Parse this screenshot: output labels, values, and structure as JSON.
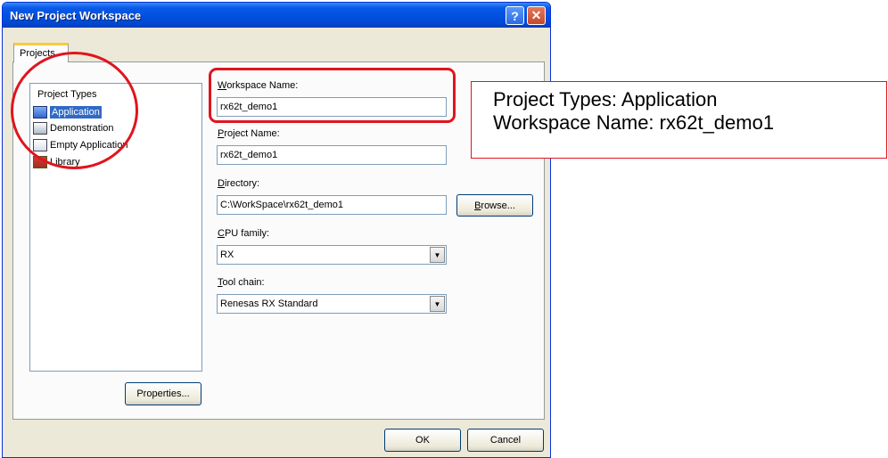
{
  "window": {
    "title": "New Project Workspace",
    "help_glyph": "?",
    "close_glyph": "✕"
  },
  "tabs": [
    {
      "label": "Projects"
    }
  ],
  "project_types": {
    "header": "Project Types",
    "items": [
      {
        "label": "Application",
        "icon": "application-icon",
        "selected": true
      },
      {
        "label": "Demonstration",
        "icon": "demonstration-icon",
        "selected": false
      },
      {
        "label": "Empty Application",
        "icon": "empty-application-icon",
        "selected": false
      },
      {
        "label": "Library",
        "icon": "library-icon",
        "selected": false
      }
    ]
  },
  "properties_button": "Properties...",
  "fields": {
    "workspace_name": {
      "label_accel": "W",
      "label_rest": "orkspace Name:",
      "value": "rx62t_demo1"
    },
    "project_name": {
      "label_accel": "P",
      "label_rest": "roject Name:",
      "value": "rx62t_demo1"
    },
    "directory": {
      "label_accel": "D",
      "label_rest": "irectory:",
      "value": "C:\\WorkSpace\\rx62t_demo1"
    },
    "cpu_family": {
      "label_accel": "C",
      "label_rest": "PU family:",
      "value": "RX"
    },
    "tool_chain": {
      "label_accel": "T",
      "label_rest": "ool chain:",
      "value": "Renesas RX Standard"
    }
  },
  "browse_button": {
    "accel": "B",
    "rest": "rowse..."
  },
  "ok_button": "OK",
  "cancel_button": "Cancel",
  "callout": {
    "line1": "Project Types: Application",
    "line2": "Workspace Name: rx62t_demo1"
  },
  "colors": {
    "annotation_red": "#e0141e",
    "selection_blue": "#316ac5",
    "titlebar_blue": "#0050e0"
  }
}
